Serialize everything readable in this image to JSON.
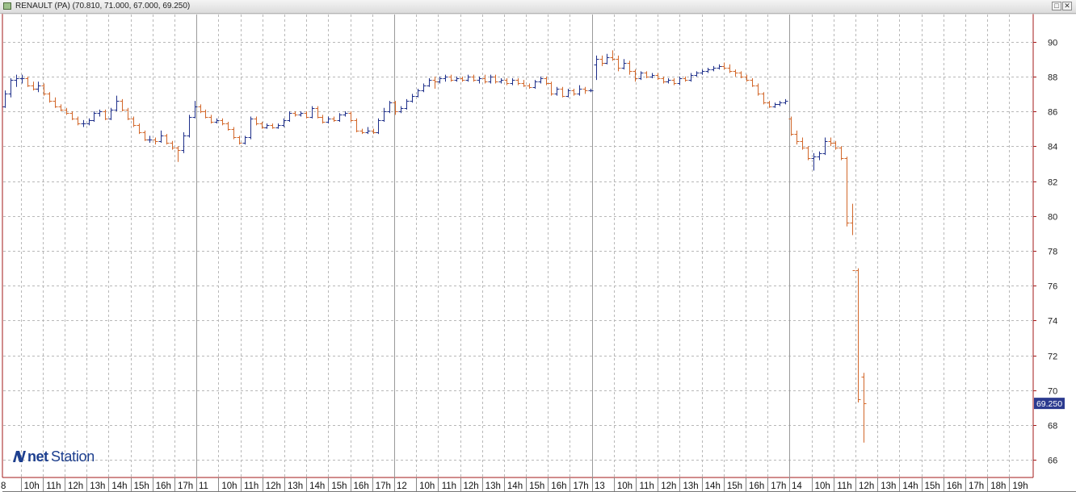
{
  "window": {
    "title": "RENAULT (PA) (70.810, 71.000, 67.000, 69.250)",
    "minimize_glyph": "□",
    "close_glyph": "✕"
  },
  "logo": {
    "part1": "net",
    "part2": "Station"
  },
  "chart_data": {
    "type": "ohlc",
    "title": "RENAULT (PA)",
    "ylim": [
      65,
      91.6
    ],
    "y_ticks": [
      66,
      68,
      70,
      72,
      74,
      76,
      78,
      80,
      82,
      84,
      86,
      88,
      90
    ],
    "grid": true,
    "last_price": "69.250",
    "colors": {
      "up": "#1e2f8a",
      "down": "#d2672a",
      "grid": "#b8b8b8",
      "axis": "#a31818",
      "price_tag": "#2b3a8f"
    },
    "x_labels": [
      "8",
      "10h",
      "11h",
      "12h",
      "13h",
      "14h",
      "15h",
      "16h",
      "17h",
      "11",
      "10h",
      "11h",
      "12h",
      "13h",
      "14h",
      "15h",
      "16h",
      "17h",
      "12",
      "10h",
      "11h",
      "12h",
      "13h",
      "14h",
      "15h",
      "16h",
      "17h",
      "13",
      "10h",
      "11h",
      "12h",
      "13h",
      "14h",
      "15h",
      "16h",
      "17h",
      "14",
      "10h",
      "11h",
      "12h",
      "13h",
      "14h",
      "15h",
      "16h",
      "17h",
      "18h",
      "19h"
    ],
    "x_label_is_day": [
      true,
      false,
      false,
      false,
      false,
      false,
      false,
      false,
      false,
      true,
      false,
      false,
      false,
      false,
      false,
      false,
      false,
      false,
      true,
      false,
      false,
      false,
      false,
      false,
      false,
      false,
      false,
      true,
      false,
      false,
      false,
      false,
      false,
      false,
      false,
      false,
      true,
      false,
      false,
      false,
      false,
      false,
      false,
      false,
      false,
      false,
      false
    ],
    "bars": [
      [
        86.3,
        87.2,
        86.2,
        87.0
      ],
      [
        87.0,
        87.9,
        86.8,
        87.8
      ],
      [
        87.8,
        88.1,
        87.4,
        87.9
      ],
      [
        87.9,
        88.1,
        87.6,
        87.9
      ],
      [
        87.9,
        88.0,
        87.4,
        87.5
      ],
      [
        87.5,
        87.7,
        87.2,
        87.3
      ],
      [
        87.3,
        87.7,
        87.1,
        87.5
      ],
      [
        87.5,
        87.6,
        86.9,
        87.0
      ],
      [
        87.0,
        87.1,
        86.5,
        86.6
      ],
      [
        86.6,
        86.8,
        86.2,
        86.3
      ],
      [
        86.3,
        86.4,
        86.0,
        86.1
      ],
      [
        86.1,
        86.2,
        85.8,
        85.9
      ],
      [
        85.9,
        86.0,
        85.5,
        85.6
      ],
      [
        85.6,
        85.7,
        85.2,
        85.3
      ],
      [
        85.3,
        85.5,
        85.1,
        85.3
      ],
      [
        85.3,
        85.6,
        85.2,
        85.5
      ],
      [
        85.5,
        86.0,
        85.4,
        85.9
      ],
      [
        85.9,
        86.1,
        85.7,
        86.0
      ],
      [
        86.0,
        86.1,
        85.5,
        85.6
      ],
      [
        85.6,
        86.2,
        85.5,
        86.1
      ],
      [
        86.1,
        86.9,
        86.0,
        86.6
      ],
      [
        86.6,
        86.7,
        86.0,
        86.1
      ],
      [
        86.1,
        86.2,
        85.5,
        85.6
      ],
      [
        85.6,
        85.7,
        85.1,
        85.2
      ],
      [
        85.2,
        85.3,
        84.7,
        84.8
      ],
      [
        84.8,
        84.9,
        84.3,
        84.4
      ],
      [
        84.4,
        84.6,
        84.2,
        84.4
      ],
      [
        84.4,
        84.5,
        84.1,
        84.3
      ],
      [
        84.3,
        84.9,
        84.2,
        84.6
      ],
      [
        84.6,
        84.7,
        84.1,
        84.2
      ],
      [
        84.2,
        84.3,
        83.8,
        83.9
      ],
      [
        83.9,
        84.0,
        83.1,
        83.8
      ],
      [
        83.8,
        84.8,
        83.6,
        84.6
      ],
      [
        84.6,
        85.8,
        84.5,
        85.7
      ],
      [
        85.7,
        86.6,
        85.6,
        86.3
      ],
      [
        86.3,
        86.4,
        85.9,
        86.0
      ],
      [
        86.0,
        86.1,
        85.6,
        85.7
      ],
      [
        85.7,
        85.8,
        85.3,
        85.4
      ],
      [
        85.4,
        85.6,
        85.3,
        85.5
      ],
      [
        85.5,
        85.6,
        85.2,
        85.3
      ],
      [
        85.3,
        85.4,
        84.9,
        85.0
      ],
      [
        85.0,
        85.1,
        84.4,
        84.5
      ],
      [
        84.5,
        84.6,
        84.1,
        84.2
      ],
      [
        84.2,
        84.6,
        84.1,
        84.5
      ],
      [
        84.5,
        85.7,
        84.4,
        85.6
      ],
      [
        85.6,
        85.7,
        85.2,
        85.3
      ],
      [
        85.3,
        85.4,
        85.0,
        85.1
      ],
      [
        85.1,
        85.3,
        85.0,
        85.2
      ],
      [
        85.2,
        85.3,
        85.0,
        85.1
      ],
      [
        85.1,
        85.3,
        85.0,
        85.2
      ],
      [
        85.2,
        85.6,
        85.1,
        85.5
      ],
      [
        85.5,
        86.0,
        85.4,
        85.9
      ],
      [
        85.9,
        86.0,
        85.7,
        85.8
      ],
      [
        85.8,
        86.0,
        85.7,
        85.9
      ],
      [
        85.9,
        86.0,
        85.6,
        85.7
      ],
      [
        85.7,
        86.3,
        85.6,
        86.2
      ],
      [
        86.2,
        86.3,
        85.6,
        85.7
      ],
      [
        85.7,
        85.8,
        85.3,
        85.4
      ],
      [
        85.4,
        85.7,
        85.3,
        85.6
      ],
      [
        85.6,
        85.7,
        85.4,
        85.5
      ],
      [
        85.5,
        85.9,
        85.4,
        85.8
      ],
      [
        85.8,
        86.0,
        85.7,
        85.9
      ],
      [
        85.9,
        86.0,
        85.4,
        85.5
      ],
      [
        85.5,
        85.6,
        84.8,
        84.9
      ],
      [
        84.9,
        85.0,
        84.7,
        84.8
      ],
      [
        84.8,
        85.1,
        84.7,
        84.9
      ],
      [
        84.9,
        85.0,
        84.7,
        84.8
      ],
      [
        84.8,
        85.6,
        84.7,
        85.5
      ],
      [
        85.5,
        86.2,
        85.4,
        86.0
      ],
      [
        86.0,
        86.6,
        85.9,
        86.5
      ],
      [
        86.5,
        86.6,
        85.8,
        86.0
      ],
      [
        86.0,
        86.3,
        85.9,
        86.2
      ],
      [
        86.2,
        86.7,
        86.1,
        86.6
      ],
      [
        86.6,
        87.0,
        86.5,
        86.9
      ],
      [
        86.9,
        87.3,
        86.8,
        87.2
      ],
      [
        87.2,
        87.6,
        87.1,
        87.5
      ],
      [
        87.5,
        87.9,
        87.4,
        87.8
      ],
      [
        87.8,
        88.0,
        87.3,
        87.7
      ],
      [
        87.7,
        88.0,
        87.6,
        87.9
      ],
      [
        87.9,
        88.1,
        87.7,
        88.0
      ],
      [
        88.0,
        88.1,
        87.7,
        87.8
      ],
      [
        87.8,
        88.0,
        87.7,
        87.9
      ],
      [
        87.9,
        88.0,
        87.7,
        87.8
      ],
      [
        87.8,
        88.1,
        87.7,
        88.0
      ],
      [
        88.0,
        88.1,
        87.7,
        87.8
      ],
      [
        87.8,
        88.0,
        87.6,
        87.9
      ],
      [
        87.9,
        88.1,
        87.6,
        87.7
      ],
      [
        87.7,
        88.1,
        87.6,
        88.0
      ],
      [
        88.0,
        88.1,
        87.6,
        87.7
      ],
      [
        87.7,
        87.9,
        87.6,
        87.8
      ],
      [
        87.8,
        87.9,
        87.5,
        87.6
      ],
      [
        87.6,
        87.9,
        87.5,
        87.8
      ],
      [
        87.8,
        87.9,
        87.5,
        87.6
      ],
      [
        87.6,
        87.8,
        87.4,
        87.5
      ],
      [
        87.5,
        87.6,
        87.3,
        87.4
      ],
      [
        87.4,
        87.8,
        87.3,
        87.7
      ],
      [
        87.7,
        88.0,
        87.6,
        87.9
      ],
      [
        87.9,
        88.0,
        87.5,
        87.6
      ],
      [
        87.6,
        87.7,
        86.9,
        87.0
      ],
      [
        87.0,
        87.4,
        86.9,
        87.3
      ],
      [
        87.3,
        87.4,
        86.8,
        86.9
      ],
      [
        86.9,
        87.3,
        86.8,
        87.2
      ],
      [
        87.2,
        87.3,
        86.9,
        87.0
      ],
      [
        87.0,
        87.5,
        86.9,
        87.3
      ],
      [
        87.3,
        87.4,
        87.0,
        87.2
      ],
      [
        87.2,
        87.3,
        87.1,
        87.2
      ],
      [
        88.7,
        89.2,
        87.8,
        89.0
      ],
      [
        89.0,
        89.2,
        88.6,
        88.8
      ],
      [
        88.8,
        89.3,
        88.7,
        89.1
      ],
      [
        89.1,
        89.5,
        88.9,
        89.0
      ],
      [
        89.0,
        89.2,
        88.3,
        88.5
      ],
      [
        88.5,
        89.0,
        88.4,
        88.8
      ],
      [
        88.8,
        88.9,
        88.1,
        88.3
      ],
      [
        88.3,
        88.4,
        87.7,
        87.9
      ],
      [
        87.9,
        88.3,
        87.8,
        88.2
      ],
      [
        88.2,
        88.3,
        87.9,
        88.0
      ],
      [
        88.0,
        88.2,
        87.9,
        88.1
      ],
      [
        88.1,
        88.2,
        87.8,
        87.9
      ],
      [
        87.9,
        88.0,
        87.6,
        87.7
      ],
      [
        87.7,
        87.9,
        87.6,
        87.8
      ],
      [
        87.8,
        87.9,
        87.5,
        87.6
      ],
      [
        87.6,
        88.0,
        87.5,
        87.9
      ],
      [
        87.9,
        88.0,
        87.7,
        87.8
      ],
      [
        87.8,
        88.2,
        87.7,
        88.1
      ],
      [
        88.1,
        88.3,
        88.0,
        88.2
      ],
      [
        88.2,
        88.4,
        88.1,
        88.3
      ],
      [
        88.3,
        88.5,
        88.2,
        88.4
      ],
      [
        88.4,
        88.6,
        88.3,
        88.5
      ],
      [
        88.5,
        88.7,
        88.4,
        88.6
      ],
      [
        88.6,
        88.8,
        88.4,
        88.5
      ],
      [
        88.5,
        88.7,
        88.2,
        88.3
      ],
      [
        88.3,
        88.4,
        88.0,
        88.2
      ],
      [
        88.2,
        88.3,
        87.9,
        88.0
      ],
      [
        88.0,
        88.1,
        87.7,
        87.8
      ],
      [
        87.8,
        87.9,
        87.4,
        87.5
      ],
      [
        87.5,
        87.6,
        86.9,
        87.0
      ],
      [
        87.0,
        87.1,
        86.4,
        86.5
      ],
      [
        86.5,
        86.6,
        86.2,
        86.3
      ],
      [
        86.3,
        86.5,
        86.2,
        86.4
      ],
      [
        86.4,
        86.6,
        86.3,
        86.5
      ],
      [
        86.5,
        86.7,
        86.4,
        86.6
      ],
      [
        85.6,
        85.7,
        84.6,
        84.7
      ],
      [
        84.7,
        84.9,
        84.1,
        84.3
      ],
      [
        84.3,
        84.5,
        83.8,
        83.9
      ],
      [
        83.9,
        84.0,
        83.2,
        83.3
      ],
      [
        83.3,
        83.6,
        82.6,
        83.4
      ],
      [
        83.4,
        83.7,
        83.2,
        83.6
      ],
      [
        83.6,
        84.5,
        83.5,
        84.3
      ],
      [
        84.3,
        84.5,
        84.0,
        84.2
      ],
      [
        84.2,
        84.3,
        83.8,
        83.9
      ],
      [
        83.9,
        84.0,
        83.2,
        83.3
      ],
      [
        83.3,
        83.4,
        79.4,
        79.6
      ],
      [
        79.6,
        80.7,
        78.9,
        76.9
      ],
      [
        76.9,
        77.0,
        69.3,
        69.5
      ],
      [
        70.8,
        71.0,
        67.0,
        69.25
      ]
    ]
  }
}
